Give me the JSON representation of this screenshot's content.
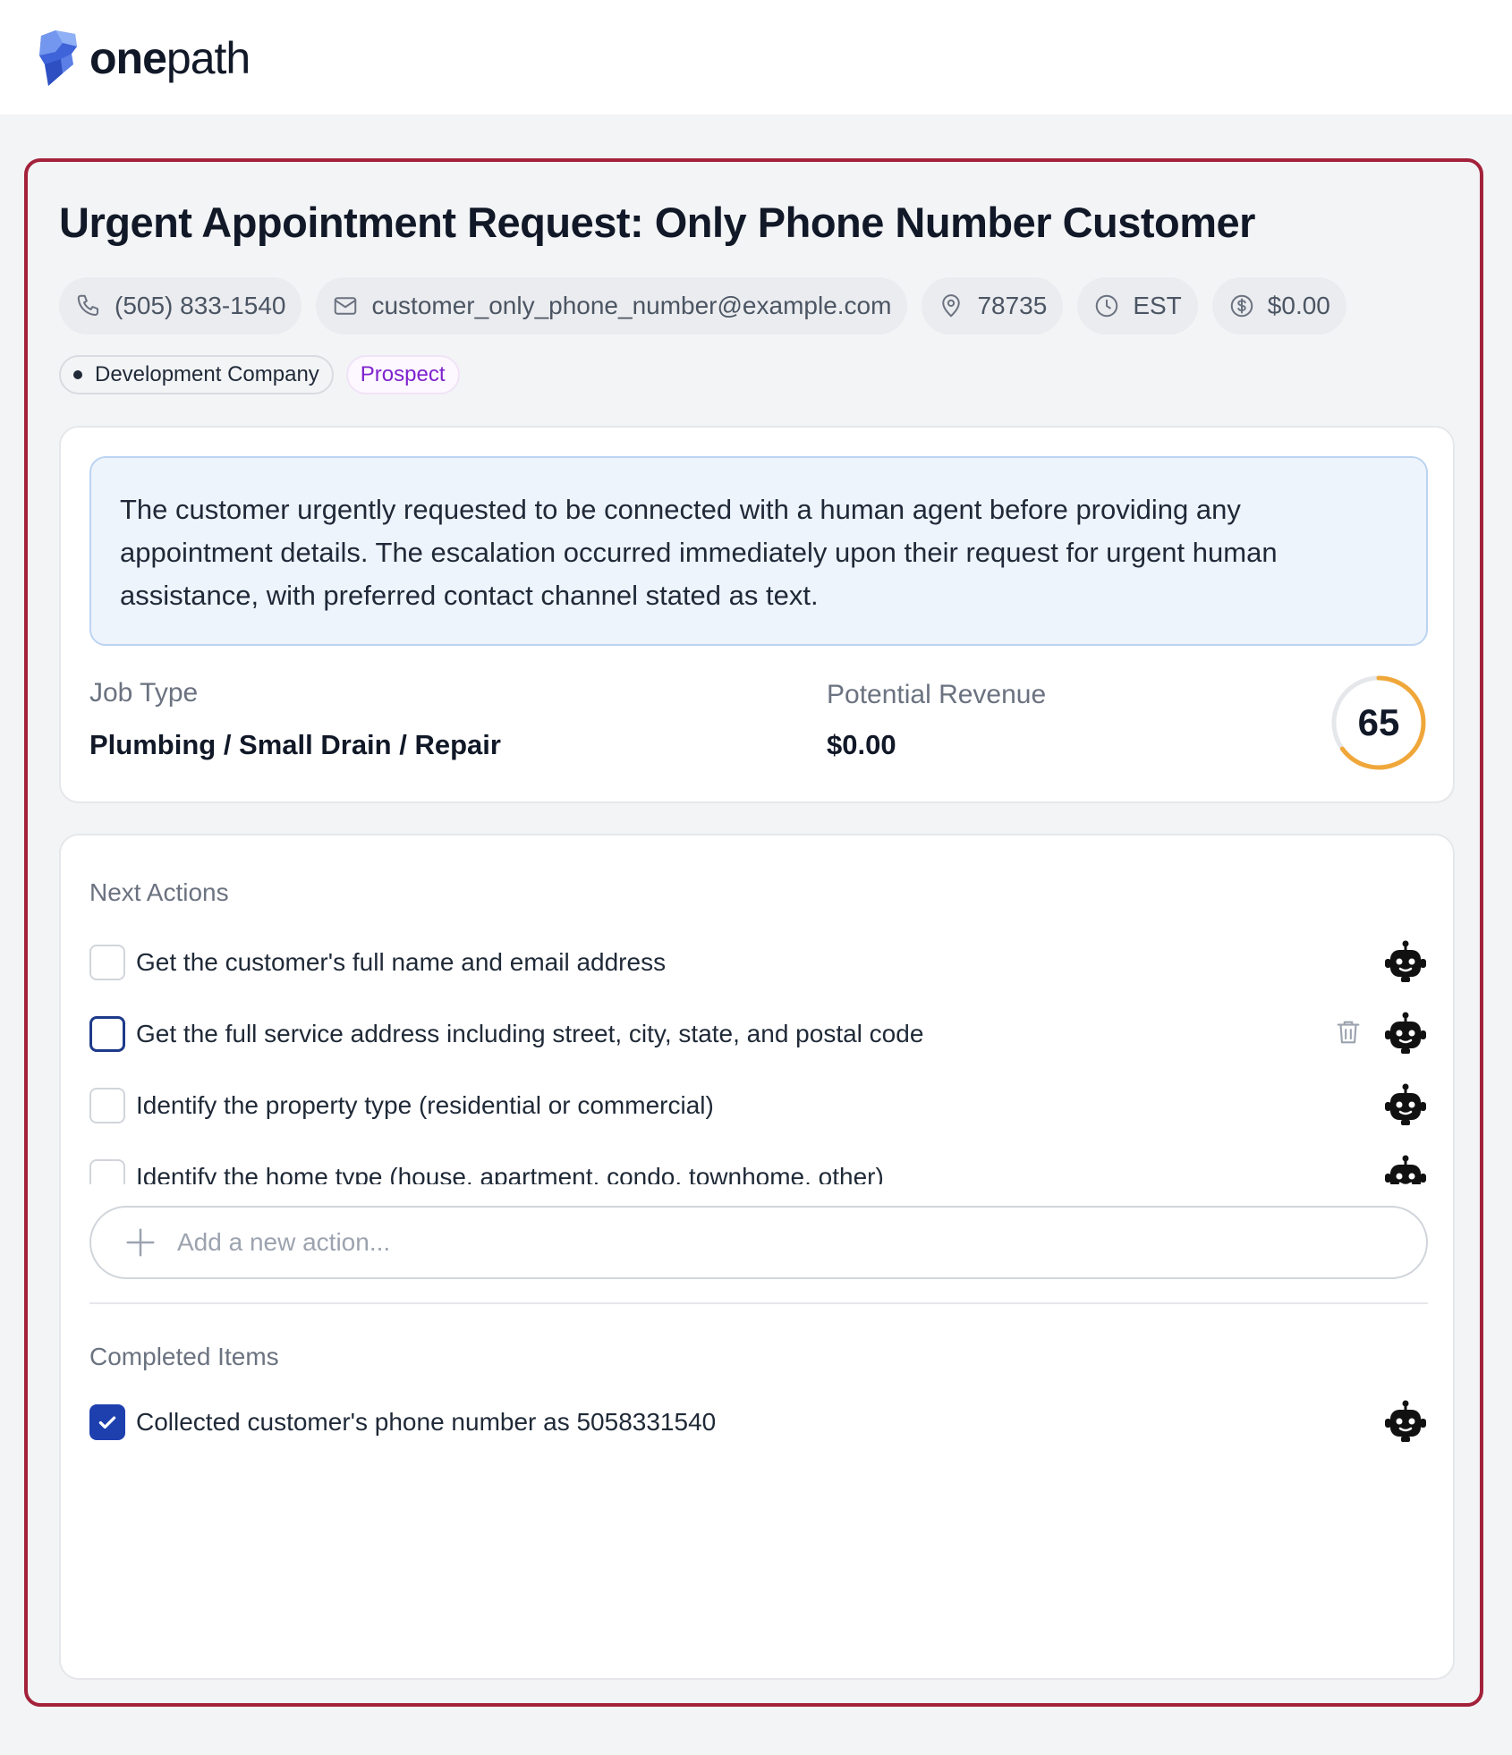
{
  "brand": {
    "name_bold": "one",
    "name_light": "path",
    "accent_color": "#a3213a"
  },
  "lead": {
    "title": "Urgent Appointment Request: Only Phone Number Customer",
    "phone": "(505) 833-1540",
    "email": "customer_only_phone_number@example.com",
    "zip": "78735",
    "timezone": "EST",
    "value": "$0.00",
    "company": "Development Company",
    "status": "Prospect",
    "summary": "The customer urgently requested to be connected with a human agent before providing any appointment details. The escalation occurred immediately upon their request for urgent human assistance, with preferred contact channel stated as text.",
    "job_type_label": "Job Type",
    "job_type": "Plumbing / Small Drain / Repair",
    "revenue_label": "Potential Revenue",
    "revenue": "$0.00",
    "score": "65",
    "score_fraction": 0.65,
    "score_color": "#f0a73a"
  },
  "actions": {
    "next_label": "Next Actions",
    "items": [
      {
        "text": "Get the customer's full name and email address"
      },
      {
        "text": "Get the full service address including street, city, state, and postal code"
      },
      {
        "text": "Identify the property type (residential or commercial)"
      },
      {
        "text": "Identify the home type (house, apartment, condo, townhome, other)"
      }
    ],
    "add_placeholder": "Add a new action...",
    "completed_label": "Completed Items",
    "completed": [
      {
        "text": "Collected customer's phone number as 5058331540"
      }
    ]
  }
}
